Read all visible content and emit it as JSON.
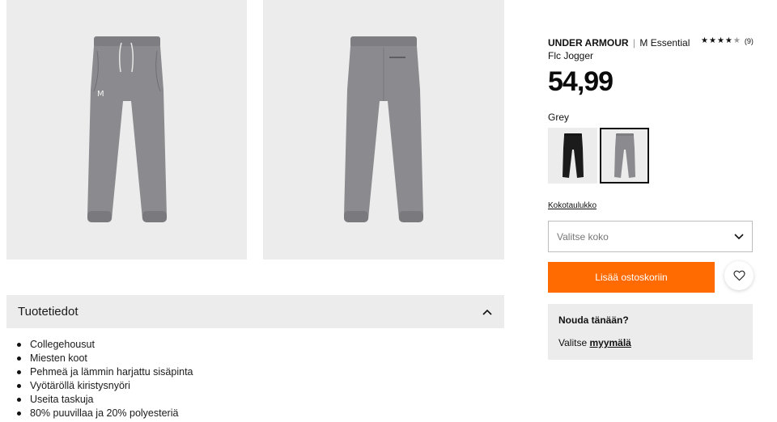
{
  "gallery": {
    "images": [
      {
        "name": "front-view",
        "color": "#8a8a8d"
      },
      {
        "name": "back-view",
        "color": "#8a8a8d"
      }
    ],
    "logo_mark": "M"
  },
  "product": {
    "brand": "UNDER ARMOUR",
    "separator": "|",
    "name": "M Essential Flc Jogger",
    "rating": {
      "stars": 4.5,
      "count": "(9)"
    },
    "price": "54,99",
    "color_label": "Grey",
    "swatches": [
      {
        "name": "black",
        "color": "#1b1b1b",
        "selected": false
      },
      {
        "name": "grey",
        "color": "#8a8a8d",
        "selected": true
      }
    ],
    "size_guide": "Kokotaulukko",
    "size_placeholder": "Valitse koko",
    "add_to_cart": "Lisää ostoskoriin"
  },
  "pickup": {
    "title": "Nouda tänään?",
    "prefix": "Valitse",
    "link": "myymälä"
  },
  "details": {
    "title": "Tuotetiedot",
    "items": [
      "Collegehousut",
      "Miesten koot",
      "Pehmeä ja lämmin harjattu sisäpinta",
      "Vyötäröllä kiristysnyöri",
      "Useita taskuja",
      "80% puuvillaa ja 20% polyesteriä"
    ]
  },
  "colors": {
    "accent": "#ff6b00",
    "panel_bg": "#ececec"
  }
}
